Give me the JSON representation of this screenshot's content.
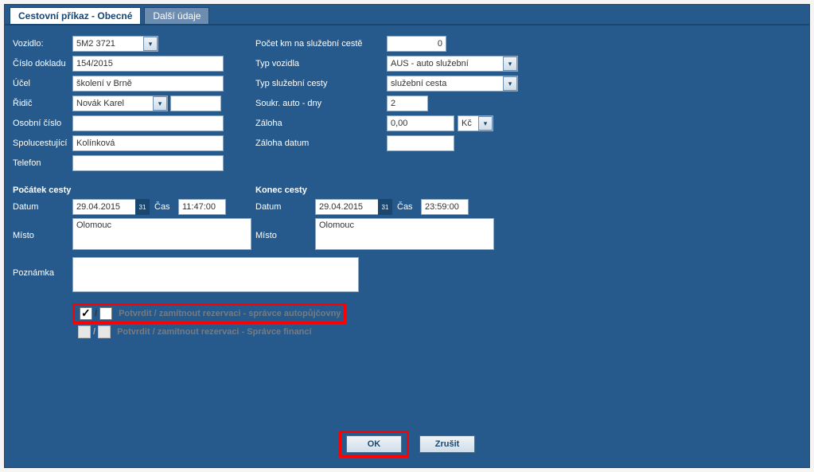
{
  "tabs": {
    "general": "Cestovní příkaz - Obecné",
    "other": "Další údaje"
  },
  "labels": {
    "vehicle": "Vozidlo:",
    "docnum": "Číslo dokladu",
    "purpose": "Účel",
    "driver": "Řidič",
    "personal_num": "Osobní číslo",
    "co_traveller": "Spolucestující",
    "phone": "Telefon",
    "km": "Počet km na služební cestě",
    "vehicle_type": "Typ vozidla",
    "trip_type": "Typ služební cesty",
    "private_days": "Soukr. auto - dny",
    "advance": "Záloha",
    "advance_date": "Záloha datum",
    "start_header": "Počátek cesty",
    "end_header": "Konec cesty",
    "date": "Datum",
    "time": "Čas",
    "place": "Místo",
    "note": "Poznámka",
    "currency": "Kč",
    "confirm1": "Potvrdit / zamítnout rezervaci - správce autopůjčovny",
    "confirm2": "Potvrdit / zamítnout rezervaci - Správce financí"
  },
  "values": {
    "vehicle": "5M2 3721",
    "docnum": "154/2015",
    "purpose": "školení v Brně",
    "driver": "Novák Karel",
    "driver_extra": "",
    "personal_num": "",
    "co_traveller": "Kolínková",
    "phone": "",
    "km": "0",
    "vehicle_type": "AUS - auto služební",
    "trip_type": "služební cesta",
    "private_days": "2",
    "advance": "0,00",
    "advance_date": "",
    "start_date": "29.04.2015",
    "start_time": "11:47:00",
    "start_place": "Olomouc",
    "end_date": "29.04.2015",
    "end_time": "23:59:00",
    "end_place": "Olomouc",
    "note": ""
  },
  "icons": {
    "calendar": "31",
    "chevron": "▾"
  },
  "buttons": {
    "ok": "OK",
    "cancel": "Zrušit"
  }
}
